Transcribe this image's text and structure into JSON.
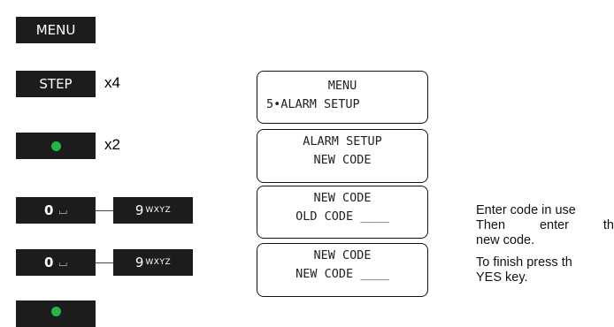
{
  "keys": {
    "menu": "MENU",
    "step": "STEP",
    "zero": "0",
    "zero_symbol": "⌴",
    "nine": "9",
    "nine_letters": "WXYZ"
  },
  "multipliers": {
    "step": "x4",
    "ok": "x2"
  },
  "lcd_screens": [
    {
      "line1": "MENU",
      "line2": "5•ALARM SETUP"
    },
    {
      "line1": "ALARM SETUP",
      "line2": "NEW CODE"
    },
    {
      "line1": "NEW CODE",
      "line2": "OLD CODE ____"
    },
    {
      "line1": "NEW CODE",
      "line2": "NEW CODE ____"
    }
  ],
  "notes": {
    "line1": "Enter code in use",
    "line2_words": [
      "Then",
      "enter",
      "th"
    ],
    "line3": "new code.",
    "line4": "To finish press th",
    "line5": "YES key."
  },
  "colors": {
    "key_bg": "#1c1c1c",
    "ok_dot": "#27b34a"
  }
}
